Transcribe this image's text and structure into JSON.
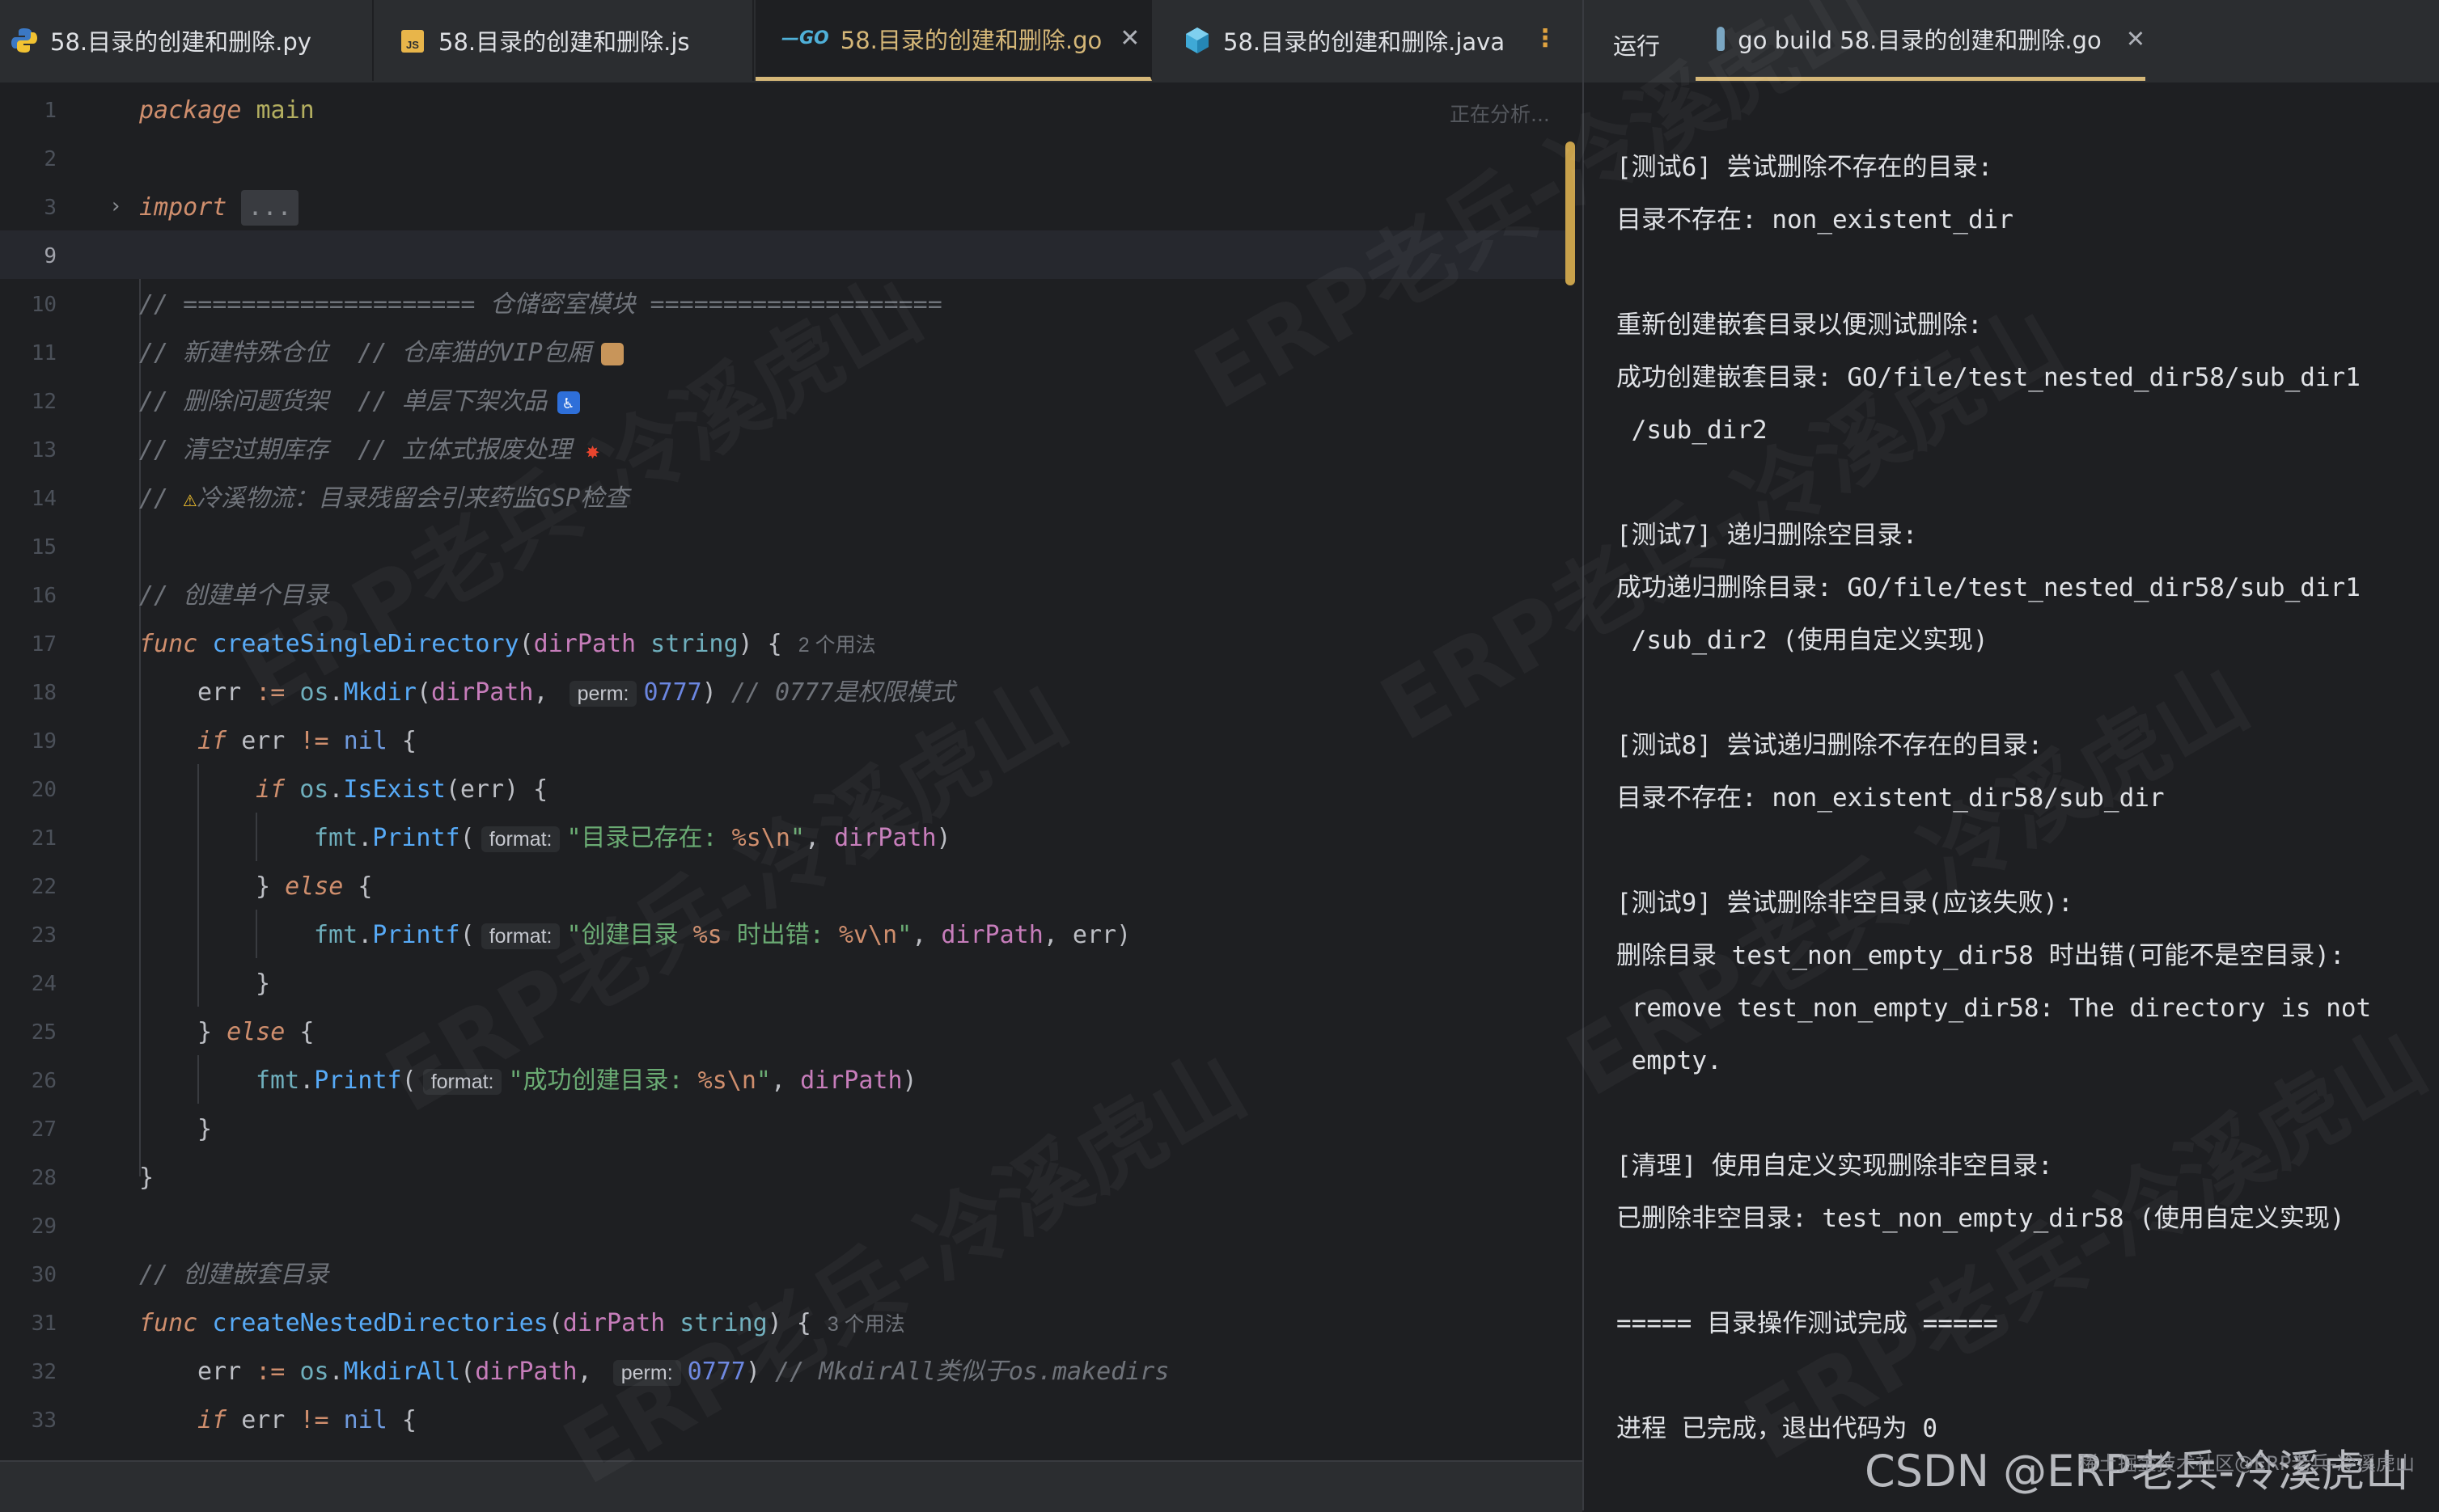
{
  "tabs": [
    {
      "label": "58.目录的创建和删除.py",
      "icon": "python-icon"
    },
    {
      "label": "58.目录的创建和删除.js",
      "icon": "js-file-icon"
    },
    {
      "label": "58.目录的创建和删除.go",
      "icon": "go-icon",
      "active": true
    },
    {
      "label": "58.目录的创建和删除.java",
      "icon": "java-icon"
    }
  ],
  "editor": {
    "analyzing": "正在分析...",
    "fold_placeholder": "...",
    "line_numbers": [
      "1",
      "2",
      "3",
      "9",
      "10",
      "11",
      "12",
      "13",
      "14",
      "15",
      "16",
      "17",
      "18",
      "19",
      "20",
      "21",
      "22",
      "23",
      "24",
      "25",
      "26",
      "27",
      "28",
      "29",
      "30",
      "31",
      "32",
      "33"
    ],
    "code": {
      "l1_kw": "package",
      "l1_name": "main",
      "l3_kw": "import",
      "l10": "// ==================== 仓储密室模块 ====================",
      "l11": "// 新建特殊仓位  // 仓库猫的VIP包厢",
      "l12": "// 删除问题货架  // 单层下架次品",
      "l13": "// 清空过期库存  // 立体式报废处理",
      "l14_a": "//",
      "l14_b": "冷溪物流：目录残留会引来药监GSP检查",
      "l16": "// 创建单个目录",
      "func": "func",
      "l17_name": "createSingleDirectory",
      "dirPath": "dirPath",
      "string": "string",
      "l17_usage": "2 个用法",
      "err": "err",
      "assign": ":=",
      "os": "os",
      "mkdir": "Mkdir",
      "mkdirall": "MkdirAll",
      "perm": "perm:",
      "perm_val": "0777",
      "l18_comment": "// 0777是权限模式",
      "if": "if",
      "neq": "!=",
      "nil": "nil",
      "isexist": "IsExist",
      "fmt": "fmt",
      "printf": "Printf",
      "format": "format:",
      "l21_str_a": "\"目录已存在: ",
      "l21_str_b": "%s\\n",
      "l21_str_c": "\"",
      "else": "else",
      "l23_str_a": "\"创建目录 ",
      "l23_str_b": "%s",
      "l23_str_c": " 时出错: ",
      "l23_str_d": "%v\\n",
      "l23_str_e": "\"",
      "l26_str_a": "\"成功创建目录: ",
      "l26_str_b": "%s\\n",
      "l26_str_c": "\"",
      "l30": "// 创建嵌套目录",
      "l31_name": "createNestedDirectories",
      "l31_usage": "3 个用法",
      "l32_comment": "// MkdirAll类似于os.makedirs"
    }
  },
  "run": {
    "label": "运行",
    "tab": "go build 58.目录的创建和删除.go",
    "lines": [
      "[测试6] 尝试删除不存在的目录:",
      "目录不存在: non_existent_dir",
      "",
      "重新创建嵌套目录以便测试删除:",
      "成功创建嵌套目录: GO/file/test_nested_dir58/sub_dir1",
      " /sub_dir2",
      "",
      "[测试7] 递归删除空目录:",
      "成功递归删除目录: GO/file/test_nested_dir58/sub_dir1",
      " /sub_dir2 (使用自定义实现)",
      "",
      "[测试8] 尝试递归删除不存在的目录:",
      "目录不存在: non_existent_dir58/sub_dir",
      "",
      "[测试9] 尝试删除非空目录(应该失败):",
      "删除目录 test_non_empty_dir58 时出错(可能不是空目录):",
      " remove test_non_empty_dir58: The directory is not",
      " empty.",
      "",
      "[清理] 使用自定义实现删除非空目录:",
      "已删除非空目录: test_non_empty_dir58 (使用自定义实现)",
      "",
      "===== 目录操作测试完成 =====",
      "",
      "进程 已完成，退出代码为 0"
    ]
  },
  "watermark": {
    "text": "ERP老兵-冷溪虎山",
    "csdn": "CSDN @ERP老兵-冷溪虎山",
    "csdn_small": "稀土掘金技术社区@ERP老兵-冷溪虎山"
  },
  "colors": {
    "accent": "#d5b778",
    "background": "#1e1f22",
    "tabbar": "#2b2d30"
  }
}
